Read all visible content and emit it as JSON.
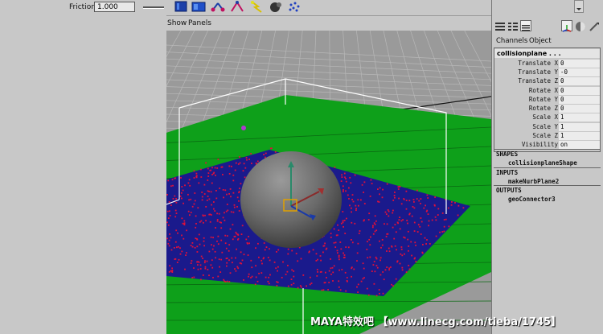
{
  "attribute_editor": {
    "friction_label": "Friction",
    "friction_value": "1.000"
  },
  "shelf": {
    "icons": [
      "field-icon",
      "rigid-body-icon",
      "emitter-icon",
      "particle-icon",
      "lightning-icon",
      "fluid-icon",
      "particles-cloud-icon"
    ]
  },
  "viewport": {
    "menu_show": "Show",
    "menu_panels": "Panels"
  },
  "channel_box": {
    "tab_channels": "Channels",
    "tab_object": "Object",
    "node_name": "collisionplane . . .",
    "attributes": [
      {
        "name": "Translate X",
        "value": "0"
      },
      {
        "name": "Translate Y",
        "value": "-0"
      },
      {
        "name": "Translate Z",
        "value": "0"
      },
      {
        "name": "Rotate X",
        "value": "0"
      },
      {
        "name": "Rotate Y",
        "value": "0"
      },
      {
        "name": "Rotate Z",
        "value": "0"
      },
      {
        "name": "Scale X",
        "value": "1"
      },
      {
        "name": "Scale Y",
        "value": "1"
      },
      {
        "name": "Scale Z",
        "value": "1"
      },
      {
        "name": "Visibility",
        "value": "on"
      }
    ],
    "shapes_header": "SHAPES",
    "shapes_item": "collisionplaneShape",
    "inputs_header": "INPUTS",
    "inputs_item": "makeNurbPlane2",
    "outputs_header": "OUTPUTS",
    "outputs_item": "geoConnector3"
  },
  "watermark": "MAYA特效吧 【www.linecg.com/tieba/1745】",
  "colors": {
    "ground": "#0ea01a",
    "plane": "#1a1a8c",
    "particles": "#e0103a",
    "sphere": "#6e6e6e",
    "panel": "#c8c8c8"
  }
}
